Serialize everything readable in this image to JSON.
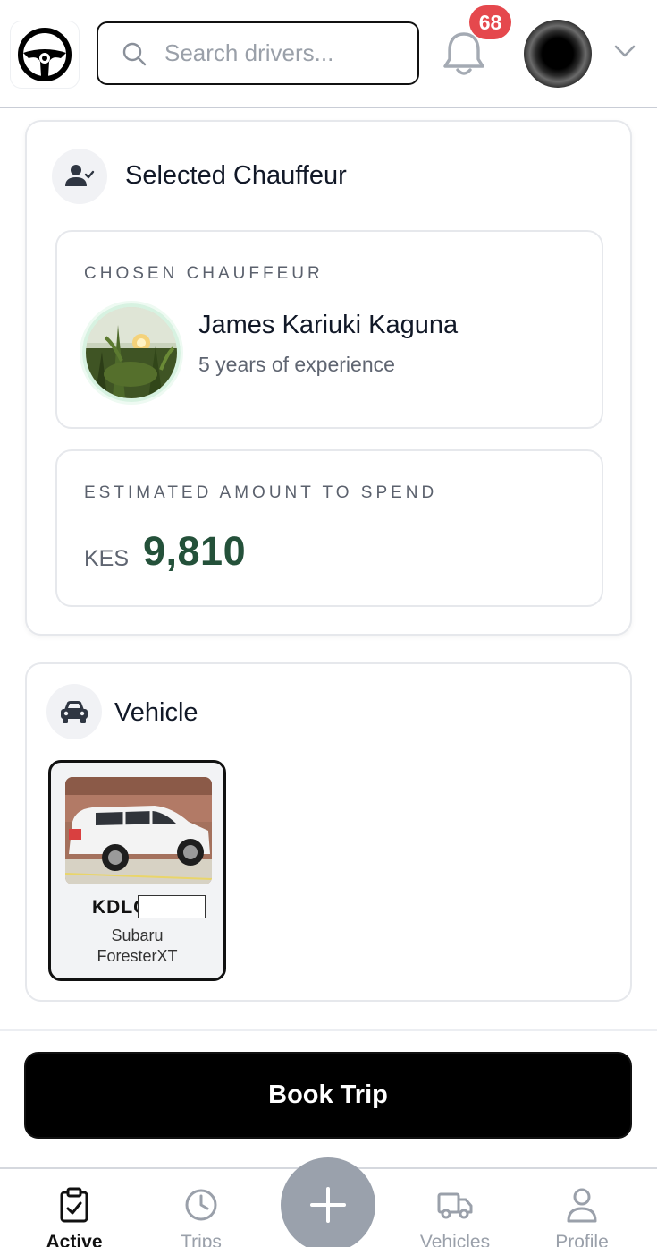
{
  "header": {
    "search_placeholder": "Search drivers...",
    "notification_count": "68",
    "icons": {
      "logo": "steering-wheel-icon",
      "search": "search-icon",
      "bell": "bell-icon",
      "dropdown": "chevron-down-icon"
    }
  },
  "chauffeur_section": {
    "title": "Selected Chauffeur",
    "icon": "user-check-icon",
    "chosen": {
      "label": "CHOSEN CHAUFFEUR",
      "name": "James Kariuki Kaguna",
      "experience": "5 years of experience"
    },
    "estimate": {
      "label": "ESTIMATED AMOUNT TO SPEND",
      "currency": "KES",
      "amount": "9,810"
    }
  },
  "vehicle_section": {
    "title": "Vehicle",
    "icon": "car-icon",
    "vehicle": {
      "plate": "KDLC",
      "make": "Subaru",
      "model": "ForesterXT"
    }
  },
  "book_button": "Book Trip",
  "bottom_nav": {
    "items": [
      {
        "label": "Active",
        "icon": "clipboard-check-icon",
        "active": true
      },
      {
        "label": "Trips",
        "icon": "clock-icon",
        "active": false
      },
      {
        "label": "Vehicles",
        "icon": "truck-icon",
        "active": false
      },
      {
        "label": "Profile",
        "icon": "user-icon",
        "active": false
      }
    ],
    "fab_icon": "plus-icon"
  },
  "colors": {
    "accent_amount": "#24513a",
    "badge": "#e5484d",
    "fab": "#9aa1ac",
    "button": "#000000"
  }
}
